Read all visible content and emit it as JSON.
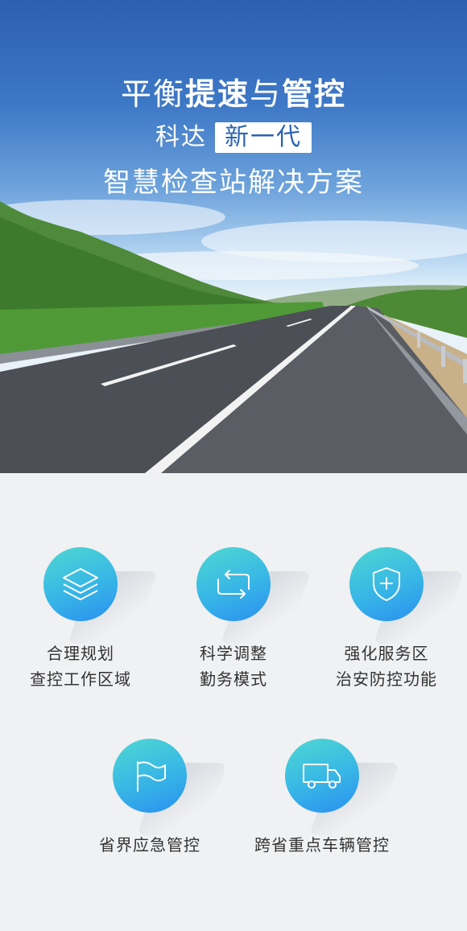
{
  "hero": {
    "line1_a": "平衡",
    "line1_b": "提速",
    "line1_c": "与",
    "line1_d": "管控",
    "line2_a": "科达",
    "line2_tag": "新一代",
    "line3": "智慧检查站解决方案"
  },
  "features": [
    {
      "icon": "layers-icon",
      "line1": "合理规划",
      "line2": "查控工作区域"
    },
    {
      "icon": "cycle-icon",
      "line1": "科学调整",
      "line2": "勤务模式"
    },
    {
      "icon": "shield-plus-icon",
      "line1": "强化服务区",
      "line2": "治安防控功能"
    },
    {
      "icon": "flag-icon",
      "line1": "省界应急管控",
      "line2": ""
    },
    {
      "icon": "truck-icon",
      "line1": "跨省重点车辆管控",
      "line2": ""
    }
  ],
  "colors": {
    "sky_top": "#2d5fb0",
    "accent_circle_start": "#4fd8d2",
    "accent_circle_end": "#2a8ff0",
    "tag_text": "#2d63b4"
  }
}
